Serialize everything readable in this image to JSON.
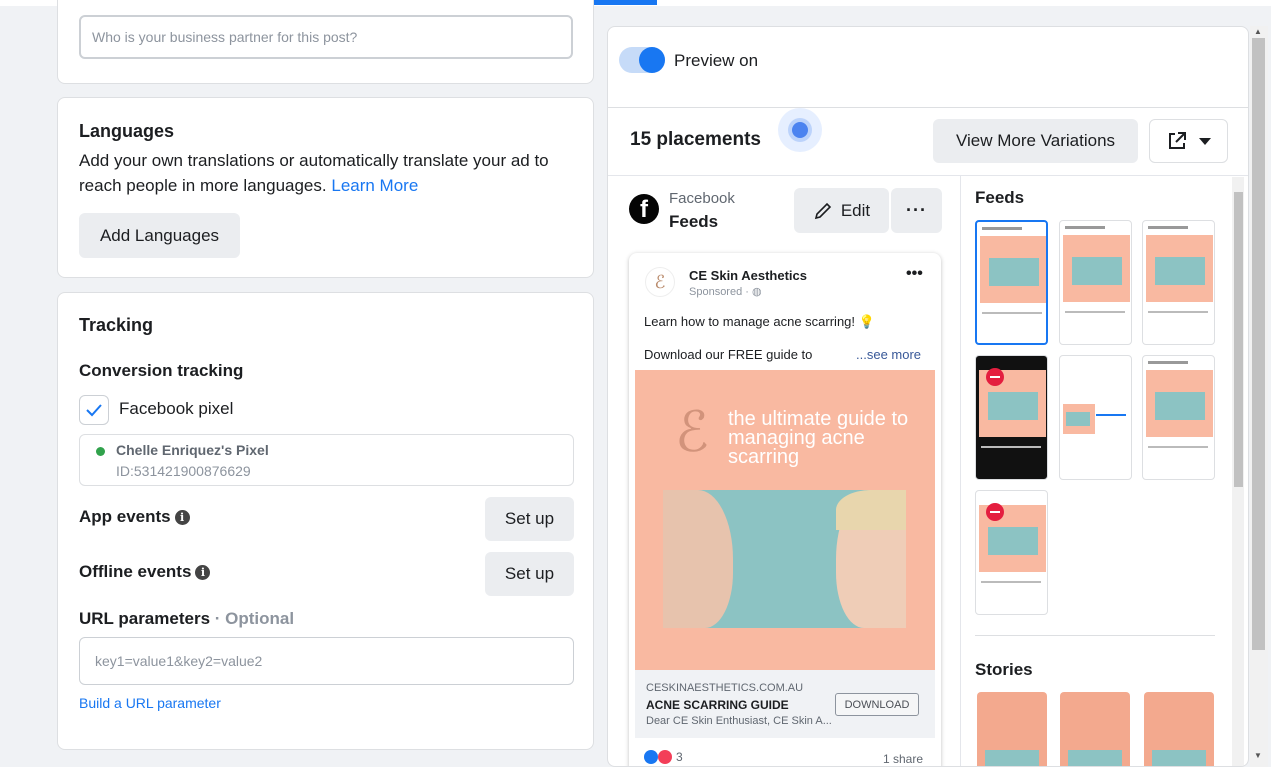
{
  "partner": {
    "placeholder": "Who is your business partner for this post?"
  },
  "languages": {
    "title": "Languages",
    "description": "Add your own translations or automatically translate your ad to reach people in more languages.",
    "learn_more": "Learn More",
    "add_button": "Add Languages"
  },
  "tracking": {
    "title": "Tracking",
    "conversion_title": "Conversion tracking",
    "pixel_checkbox_label": "Facebook pixel",
    "pixel_name": "Chelle Enriquez's Pixel",
    "pixel_id": "ID:531421900876629",
    "pixel_status_color": "#31a24c",
    "app_events": "App events",
    "offline_events": "Offline events",
    "setup_label": "Set up",
    "url_params_title": "URL parameters",
    "url_params_optional": "· Optional",
    "url_params_placeholder": "key1=value1&key2=value2",
    "build_link": "Build a URL parameter"
  },
  "preview": {
    "toggle_label": "Preview on",
    "placements_count": "15 placements",
    "view_more_button": "View More Variations",
    "network": "Facebook",
    "placement": "Feeds",
    "edit_button": "Edit",
    "more_button": "···"
  },
  "ad": {
    "page_name": "CE Skin Aesthetics",
    "sponsored": "Sponsored · ",
    "primary_text_1": "Learn how to manage acne scarring! 💡",
    "primary_text_2": "Download our FREE guide to",
    "see_more": "...see more",
    "image_headline": "the ultimate guide to managing acne scarring",
    "domain": "CESKINAESTHETICS.COM.AU",
    "headline": "ACNE SCARRING GUIDE",
    "description": "Dear CE Skin Enthusiast, CE Skin A...",
    "cta": "DOWNLOAD",
    "reactions_count": "3",
    "shares": "1 share",
    "image_color": "#f9b9a1"
  },
  "thumbnails": {
    "feeds_title": "Feeds",
    "stories_title": "Stories"
  },
  "colors": {
    "accent": "#1877f2",
    "link": "#1877f2"
  }
}
